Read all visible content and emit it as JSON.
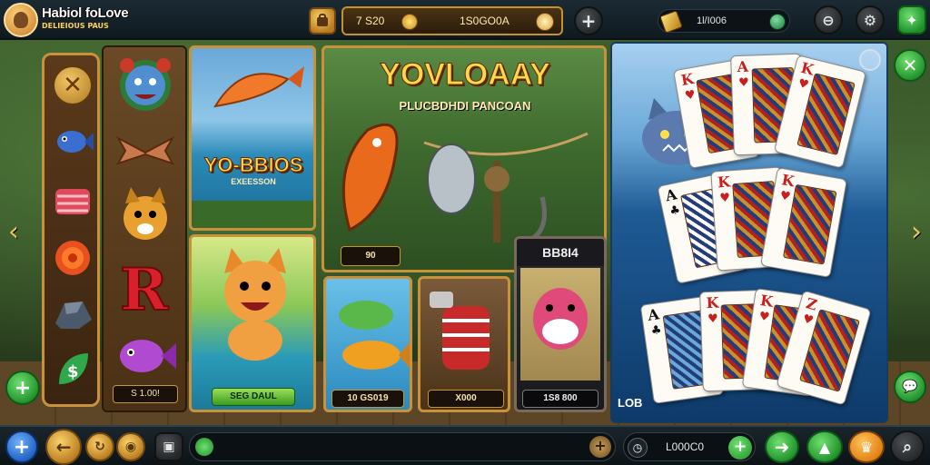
{
  "header": {
    "brand_title": "Habiol foLove",
    "brand_sub": "DELIEIOUS PAUS",
    "balance_left": "7 S20",
    "balance_right": "1S0GO0A",
    "gold_value": "1l/I006"
  },
  "left_tools": [
    {
      "name": "close-tool",
      "icon": "close-icon"
    },
    {
      "name": "fish-tool",
      "icon": "fish-icon"
    },
    {
      "name": "meat-tool",
      "icon": "meat-icon"
    },
    {
      "name": "flower-tool",
      "icon": "rose-icon"
    },
    {
      "name": "rock-tool",
      "icon": "rock-icon"
    },
    {
      "name": "leaf-tool",
      "icon": "leaf-icon"
    }
  ],
  "symbols_column": {
    "price": "S 1.00!",
    "items": [
      "bear-symbol",
      "scissors-symbol",
      "dog-symbol",
      "r-symbol",
      "purple-fish-symbol"
    ]
  },
  "tiles": {
    "bios": {
      "title": "YO-BBIOS",
      "sub": "EXEESSON"
    },
    "big": {
      "title": "YOVLOAAY",
      "sub": "PLUCBDHDI PANCOAN",
      "price": "90"
    },
    "cat": {
      "price": "SEG DAUL"
    },
    "fish": {
      "price": "10 GS019"
    },
    "barrel": {
      "price": "X000"
    },
    "weasel": {
      "title": "BB8I4",
      "price": "1S8 800"
    }
  },
  "card_panel": {
    "label": "LOB",
    "cards": [
      {
        "rank": "K",
        "suit": "♥",
        "color": "red"
      },
      {
        "rank": "A",
        "suit": "♥",
        "color": "red"
      },
      {
        "rank": "K",
        "suit": "♥",
        "color": "red"
      },
      {
        "rank": "A",
        "suit": "♣",
        "color": "blk"
      },
      {
        "rank": "K",
        "suit": "♥",
        "color": "red"
      },
      {
        "rank": "K",
        "suit": "♥",
        "color": "red"
      },
      {
        "rank": "A",
        "suit": "♣",
        "color": "blk"
      },
      {
        "rank": "K",
        "suit": "♥",
        "color": "red"
      },
      {
        "rank": "K",
        "suit": "♥",
        "color": "red"
      },
      {
        "rank": "Z",
        "suit": "♥",
        "color": "red"
      }
    ]
  },
  "bottom": {
    "value": "L000C0"
  },
  "colors": {
    "gold": "#c8923a",
    "bar_bg": "#0f1a20",
    "green": "#1f8f2a"
  }
}
